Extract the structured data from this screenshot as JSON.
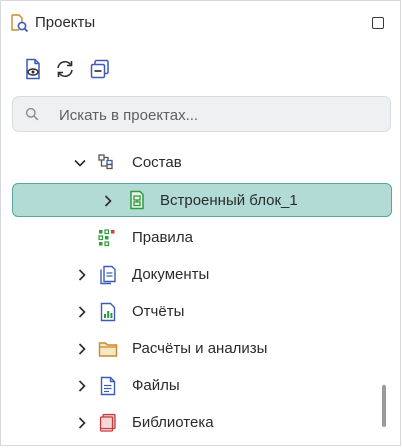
{
  "panel": {
    "title": "Проекты",
    "title_icon": "project-search-icon",
    "maximize_icon": "maximize-icon"
  },
  "toolbar": {
    "buttons": [
      {
        "icon": "view-document-icon"
      },
      {
        "icon": "refresh-icon"
      },
      {
        "icon": "collapse-all-icon"
      }
    ]
  },
  "search": {
    "placeholder": "Искать в проектах...",
    "value": ""
  },
  "tree": {
    "items": [
      {
        "label": "Состав",
        "icon": "structure-icon",
        "expanded": true
      },
      {
        "label": "Встроенный блок_1",
        "icon": "embedded-block-icon",
        "expanded": false,
        "selected": true
      },
      {
        "label": "Правила",
        "icon": "rules-icon"
      },
      {
        "label": "Документы",
        "icon": "documents-icon",
        "expanded": false
      },
      {
        "label": "Отчёты",
        "icon": "reports-icon",
        "expanded": false
      },
      {
        "label": "Расчёты и анализы",
        "icon": "folder-icon",
        "expanded": false
      },
      {
        "label": "Файлы",
        "icon": "files-icon",
        "expanded": false
      },
      {
        "label": "Библиотека",
        "icon": "library-icon",
        "expanded": false
      }
    ]
  },
  "colors": {
    "selection_bg": "#b3dbd6",
    "selection_border": "#5aa69c",
    "accent_blue": "#3f5bb5",
    "accent_green": "#2e9a3e"
  }
}
